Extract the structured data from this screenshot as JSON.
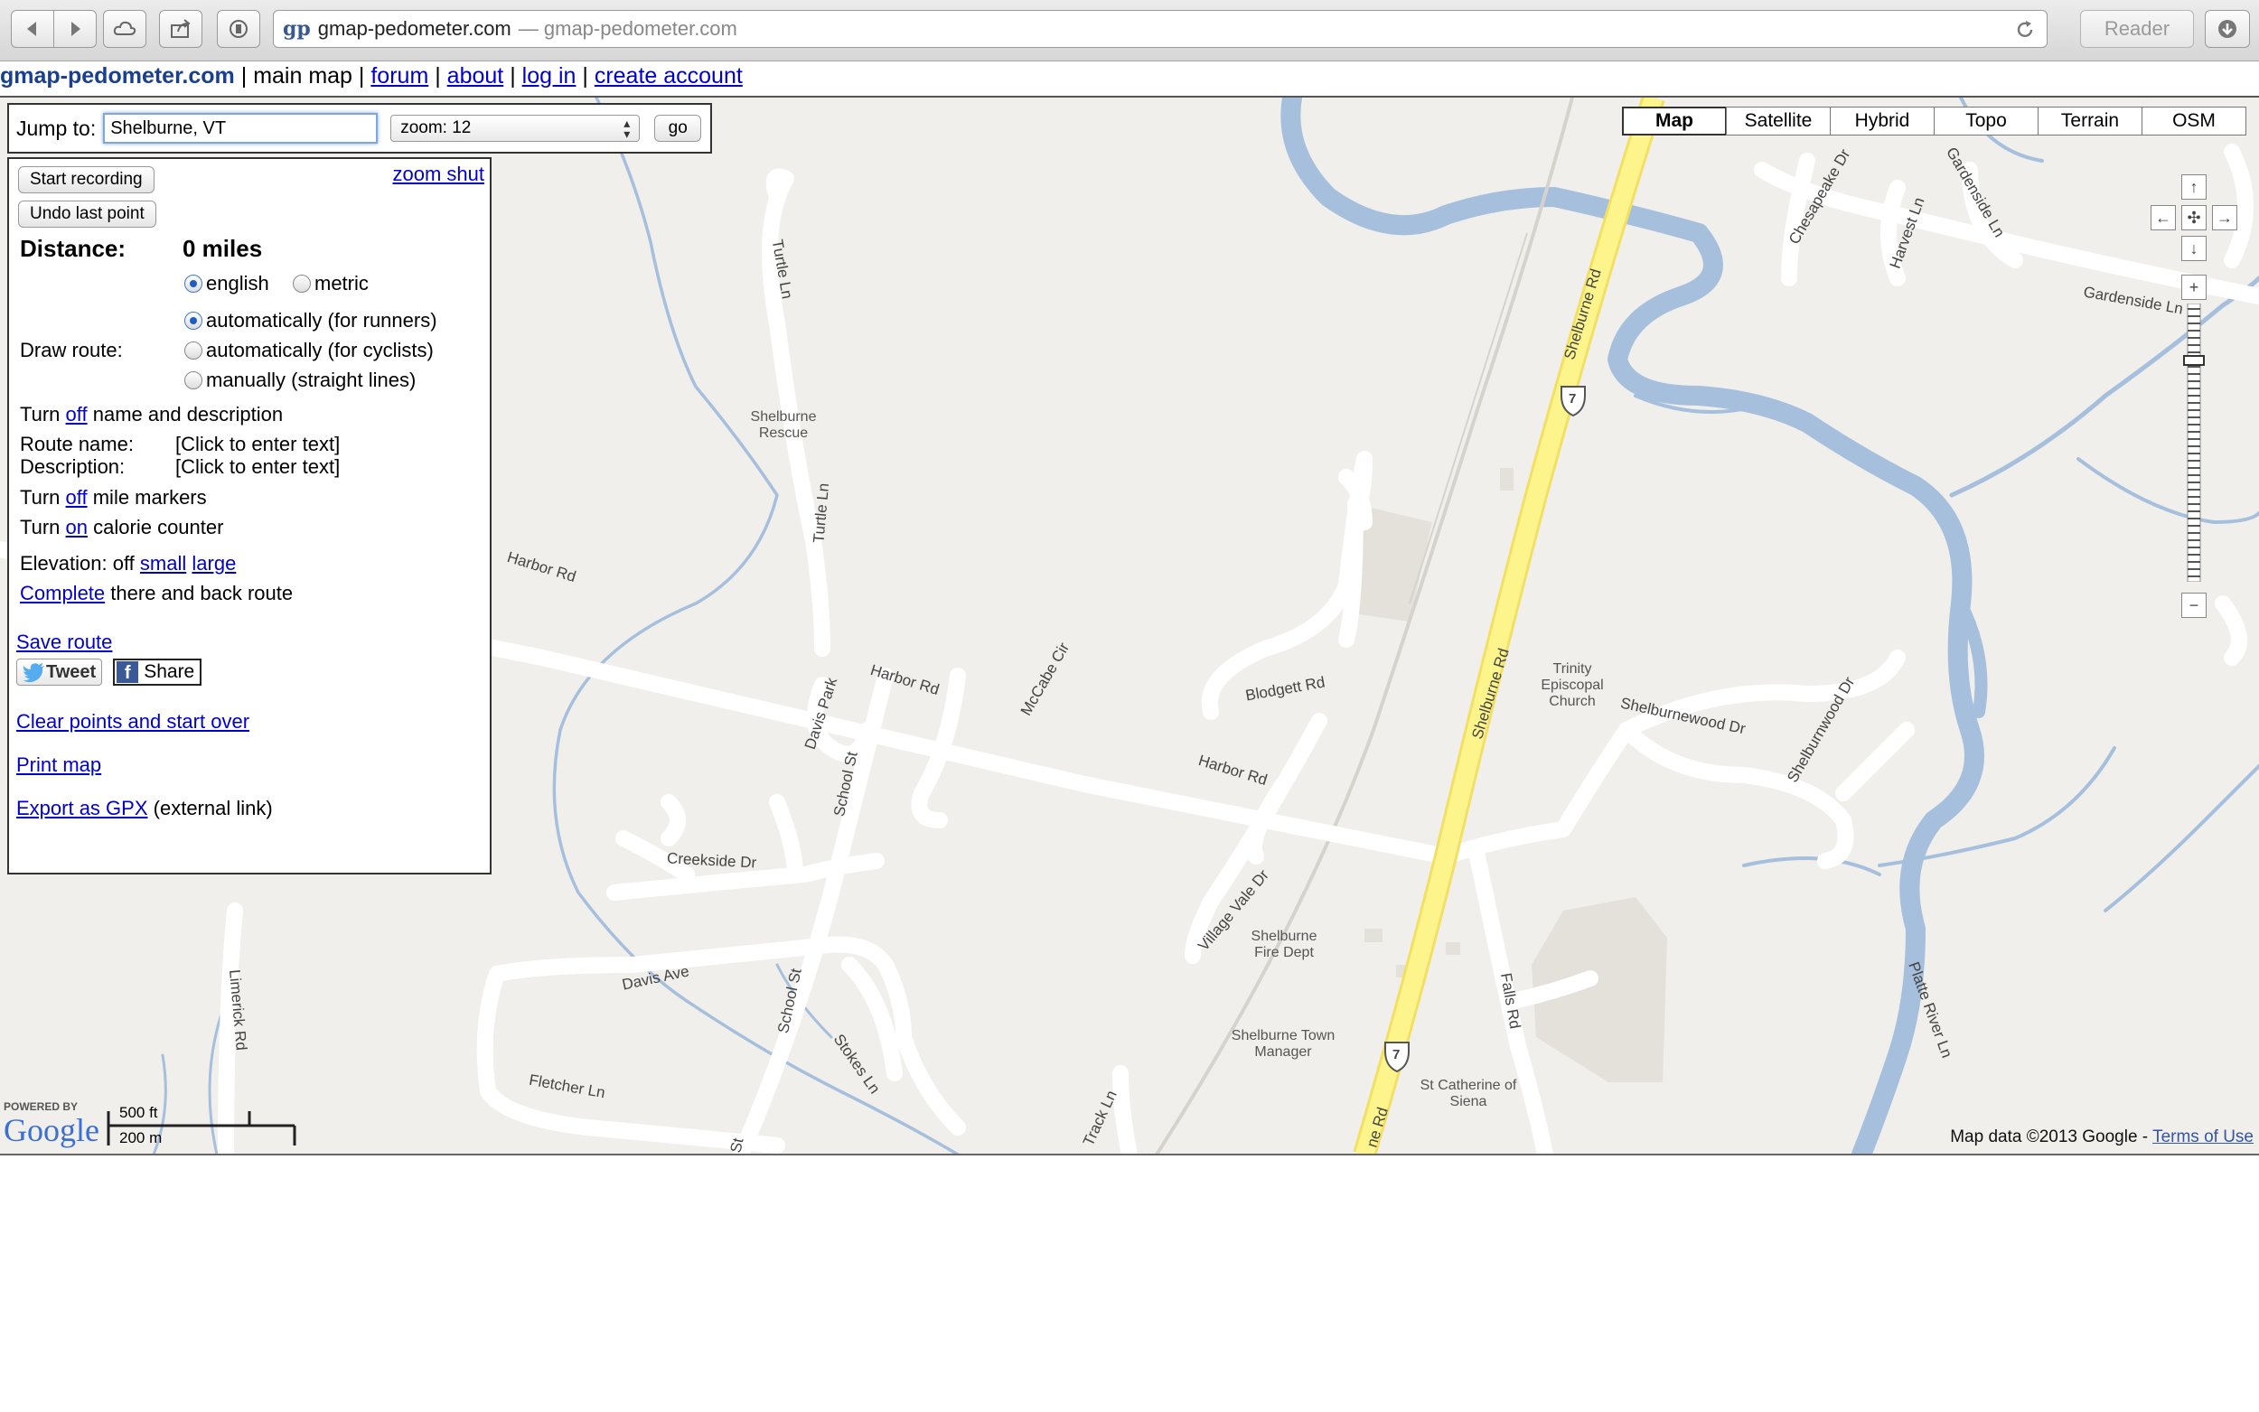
{
  "browser": {
    "favicon": "gp",
    "host": "gmap-pedometer.com",
    "title_suffix": "— gmap-pedometer.com",
    "reader_label": "Reader",
    "icons": [
      "back-icon",
      "forward-icon",
      "cloud-icon",
      "share-icon",
      "privacy-icon",
      "reload-icon",
      "download-icon"
    ]
  },
  "header": {
    "brand": "gmap-pedometer.com",
    "sep": "|",
    "main_map": "main map",
    "forum": "forum",
    "about": "about",
    "login": "log in",
    "create": "create account"
  },
  "jump": {
    "label": "Jump to:",
    "value": "Shelburne, VT",
    "zoom": "zoom: 12",
    "go": "go"
  },
  "panel": {
    "zoom_shut": "zoom shut",
    "start_recording": "Start recording",
    "undo": "Undo last point",
    "distance_label": "Distance:",
    "distance_value": "0 miles",
    "units": [
      "english",
      "metric"
    ],
    "units_selected": "english",
    "draw_label": "Draw route:",
    "draw_options": [
      "automatically (for runners)",
      "automatically (for cyclists)",
      "manually (straight lines)"
    ],
    "draw_selected": 0,
    "turn": "Turn",
    "off": "off",
    "on": "on",
    "name_desc_rest": "name and description",
    "route_name_label": "Route name:",
    "route_name_value": "[Click to enter text]",
    "description_label": "Description:",
    "description_value": "[Click to enter text]",
    "mile_markers_rest": "mile markers",
    "calorie_rest": "calorie counter",
    "elevation_label": "Elevation: off",
    "elevation_small": "small",
    "elevation_large": "large",
    "complete_link": "Complete",
    "complete_rest": "there and back route",
    "save_route": "Save route",
    "tweet": "Tweet",
    "share": "Share",
    "clear": "Clear points and start over",
    "print": "Print map",
    "export_link": "Export as GPX",
    "export_rest": "(external link)"
  },
  "map": {
    "types": [
      "Map",
      "Satellite",
      "Hybrid",
      "Topo",
      "Terrain",
      "OSM"
    ],
    "selected_type": "Map",
    "attribution": "Map data ©2013 Google -",
    "terms": "Terms of Use",
    "powered_by": "POWERED BY",
    "google": "Google",
    "scale_ft": "500 ft",
    "scale_m": "200 m",
    "roads": {
      "harbor_rd_1": "Harbor Rd",
      "harbor_rd_2": "Harbor Rd",
      "harbor_rd_3": "Harbor Rd",
      "shelburne_rd_1": "Shelburne Rd",
      "shelburne_rd_2": "Shelburne Rd",
      "shelburne_rd_3": "ne Rd",
      "turtle_ln_1": "Turtle Ln",
      "turtle_ln_2": "Turtle Ln",
      "school_st_1": "School St",
      "school_st_2": "School St",
      "school_st_3": "St",
      "davis_park": "Davis Park",
      "mccabe_cir": "McCabe Cir",
      "blodgett_rd": "Blodgett Rd",
      "creekside_dr": "Creekside Dr",
      "davis_ave": "Davis Ave",
      "fletcher_ln": "Fletcher Ln",
      "stokes_ln": "Stokes Ln",
      "limerick_rd": "Limerick Rd",
      "village_vale_dr": "Village Vale Dr",
      "falls_rd": "Falls Rd",
      "shelburnewood_dr": "Shelburnewood Dr",
      "shelburnwood": "Shelburnwood Dr",
      "platte_river_ln": "Platte River Ln",
      "gardenside_ln_1": "Gardenside Ln",
      "gardenside_ln_2": "Gardenside Ln",
      "chesapeake_dr": "Chesapeake Dr",
      "harvest_ln": "Harvest Ln",
      "track_ln": "Track Ln",
      "route7": "7"
    },
    "pois": {
      "rescue": "Shelburne Rescue",
      "trinity": "Trinity Episcopal Church",
      "fire": "Shelburne Fire Dept",
      "town_manager": "Shelburne Town Manager",
      "st_catherine": "St Catherine of Siena"
    }
  }
}
